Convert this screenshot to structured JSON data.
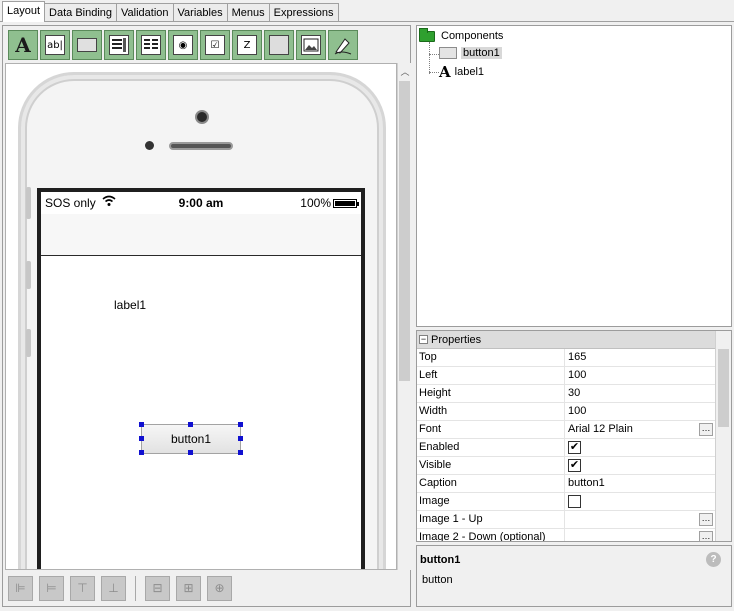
{
  "tabs": [
    "Layout",
    "Data Binding",
    "Validation",
    "Variables",
    "Menus",
    "Expressions"
  ],
  "palette_icons": [
    "label-tool-icon",
    "textbox-tool-icon",
    "button-tool-icon",
    "listbox-tool-icon",
    "multi-column-list-icon",
    "radio-tool-icon",
    "checkbox-tool-icon",
    "timer-tool-icon",
    "image-tool-icon",
    "picture-tool-icon",
    "signature-tool-icon"
  ],
  "palette_text": {
    "textbox": "ab|",
    "radio": "◉",
    "checkbox": "☑",
    "timer": "Z"
  },
  "phone": {
    "carrier": "SOS only",
    "time": "9:00 am",
    "battery": "100%",
    "label_text": "label1",
    "button_text": "button1"
  },
  "tree": {
    "root": "Components",
    "items": [
      {
        "name": "button1",
        "type": "button"
      },
      {
        "name": "label1",
        "type": "label"
      }
    ]
  },
  "properties": {
    "header": "Properties",
    "rows": [
      {
        "name": "Top",
        "value": "165"
      },
      {
        "name": "Left",
        "value": "100"
      },
      {
        "name": "Height",
        "value": "30"
      },
      {
        "name": "Width",
        "value": "100"
      },
      {
        "name": "Font",
        "value": "Arial 12 Plain",
        "ellipsis": true
      },
      {
        "name": "Enabled",
        "checkbox": true,
        "checked": true
      },
      {
        "name": "Visible",
        "checkbox": true,
        "checked": true
      },
      {
        "name": "Caption",
        "value": "button1"
      },
      {
        "name": "Image",
        "checkbox": true,
        "checked": false
      },
      {
        "name": "Image 1 - Up",
        "value": "",
        "ellipsis": true
      },
      {
        "name": "Image 2 - Down (optional)",
        "value": "",
        "ellipsis": true
      }
    ]
  },
  "info": {
    "title": "button1",
    "description": "button"
  }
}
